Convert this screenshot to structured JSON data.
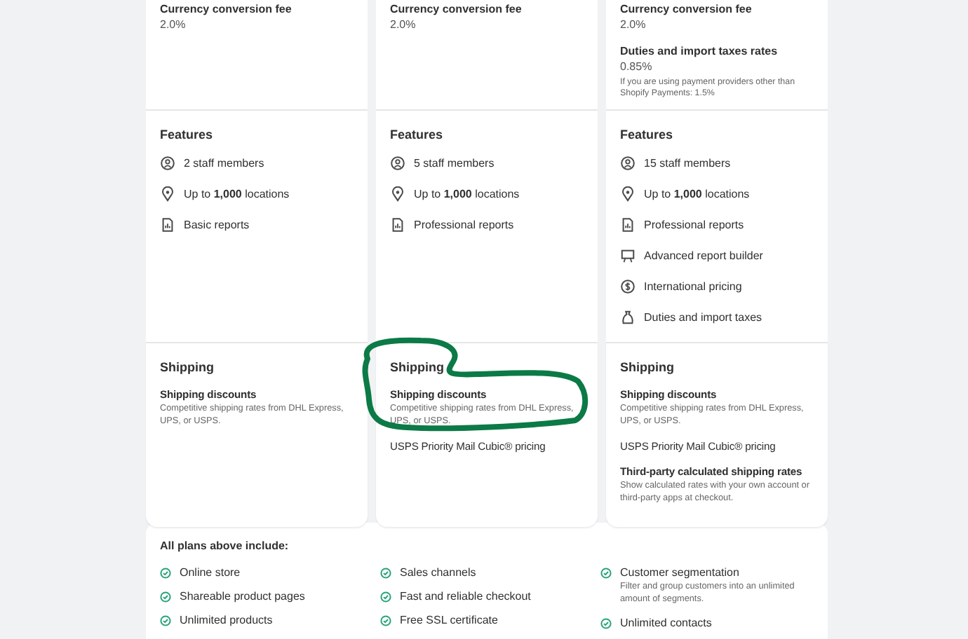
{
  "plans": [
    {
      "fees": [
        {
          "label": "Currency conversion fee",
          "value": "2.0%"
        }
      ],
      "features": {
        "title": "Features",
        "items": [
          {
            "kind": "staff",
            "text": "2 staff members"
          },
          {
            "kind": "location",
            "text": "Up to **1,000** locations"
          },
          {
            "kind": "report",
            "text": "Basic reports"
          }
        ]
      },
      "shipping": {
        "title": "Shipping",
        "items": [
          {
            "title": "Shipping discounts",
            "description": "Competitive shipping rates from DHL Express, UPS, or USPS."
          }
        ]
      }
    },
    {
      "fees": [
        {
          "label": "Currency conversion fee",
          "value": "2.0%"
        }
      ],
      "features": {
        "title": "Features",
        "items": [
          {
            "kind": "staff",
            "text": "5 staff members"
          },
          {
            "kind": "location",
            "text": "Up to **1,000** locations"
          },
          {
            "kind": "report",
            "text": "Professional reports"
          }
        ]
      },
      "shipping": {
        "title": "Shipping",
        "items": [
          {
            "title": "Shipping discounts",
            "description": "Competitive shipping rates from DHL Express, UPS, or USPS."
          },
          {
            "title": "USPS Priority Mail Cubic® pricing"
          }
        ]
      }
    },
    {
      "fees": [
        {
          "label": "Currency conversion fee",
          "value": "2.0%"
        },
        {
          "label": "Duties and import taxes rates",
          "value": "0.85%",
          "note": "If you are using payment providers other than Shopify Payments: 1.5%"
        }
      ],
      "features": {
        "title": "Features",
        "items": [
          {
            "kind": "staff",
            "text": "15 staff members"
          },
          {
            "kind": "location",
            "text": "Up to **1,000** locations"
          },
          {
            "kind": "report",
            "text": "Professional reports"
          },
          {
            "kind": "builder",
            "text": "Advanced report builder"
          },
          {
            "kind": "pricing",
            "text": "International pricing"
          },
          {
            "kind": "duties",
            "text": "Duties and import taxes"
          }
        ]
      },
      "shipping": {
        "title": "Shipping",
        "items": [
          {
            "title": "Shipping discounts",
            "description": "Competitive shipping rates from DHL Express, UPS, or USPS."
          },
          {
            "title": "USPS Priority Mail Cubic® pricing"
          },
          {
            "title": "Third-party calculated shipping rates",
            "description": "Show calculated rates with your own account or third-party apps at checkout."
          }
        ]
      }
    }
  ],
  "included": {
    "title": "All plans above include:",
    "columns": [
      [
        {
          "text": "Online store"
        },
        {
          "text": "Shareable product pages"
        },
        {
          "text": "Unlimited products"
        }
      ],
      [
        {
          "text": "Sales channels"
        },
        {
          "text": "Fast and reliable checkout"
        },
        {
          "text": "Free SSL certificate"
        }
      ],
      [
        {
          "text": "Customer segmentation",
          "description": "Filter and group customers into an unlimited amount of segments."
        },
        {
          "text": "Unlimited contacts"
        }
      ]
    ]
  }
}
